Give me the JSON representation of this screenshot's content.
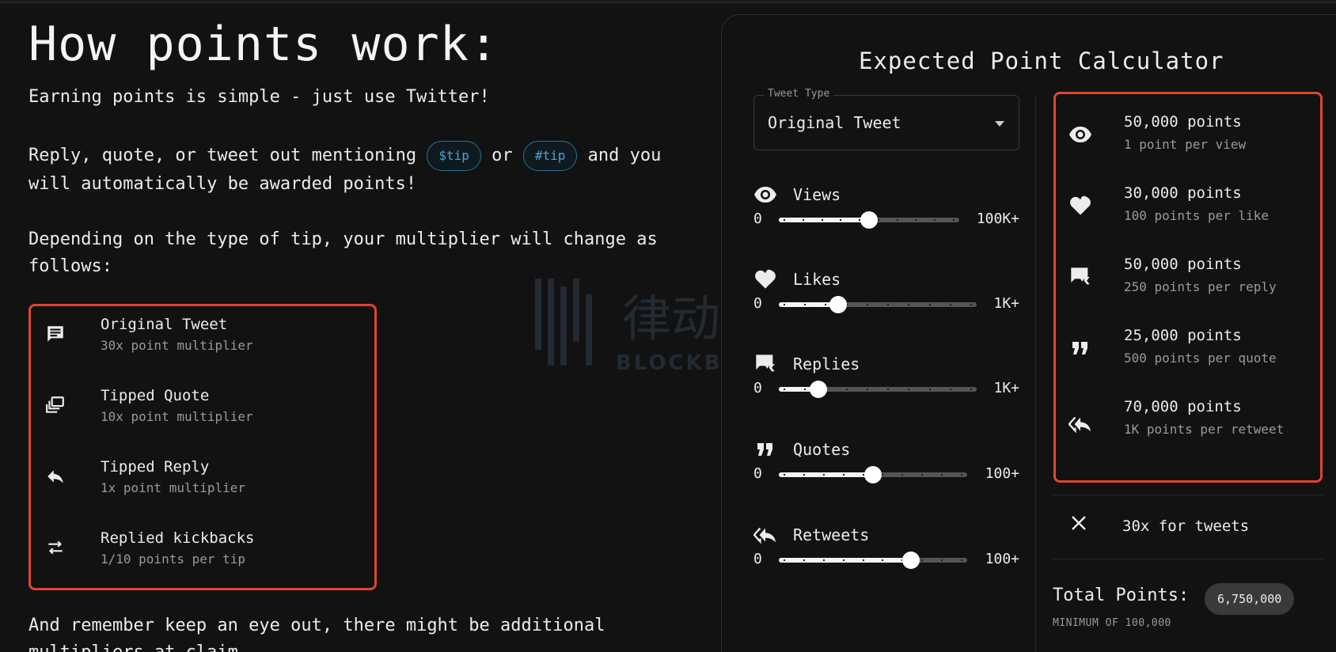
{
  "left": {
    "title": "How points work:",
    "intro": "Earning points is simple - just use Twitter!",
    "mention_pre": "Reply, quote, or tweet out mentioning",
    "tag1": "$tip",
    "mention_or": "or",
    "tag2": "#tip",
    "mention_post": "and you will automatically be awarded points!",
    "depending": "Depending on the type of tip, your multiplier will change as follows:",
    "multipliers": [
      {
        "icon": "comment-icon",
        "title": "Original Tweet",
        "desc": "30x point multiplier"
      },
      {
        "icon": "quote-stack-icon",
        "title": "Tipped Quote",
        "desc": "10x point multiplier"
      },
      {
        "icon": "reply-icon",
        "title": "Tipped Reply",
        "desc": "1x point multiplier"
      },
      {
        "icon": "swap-icon",
        "title": "Replied kickbacks",
        "desc": "1/10 points per tip"
      }
    ],
    "remember": "And remember keep an eye out, there might be additional multipliers at claim"
  },
  "calculator": {
    "title": "Expected Point Calculator",
    "tweet_type_label": "Tweet Type",
    "tweet_type_value": "Original Tweet",
    "sliders": [
      {
        "icon": "eye-icon",
        "label": "Views",
        "min": "0",
        "max": "100K+",
        "value_fraction": 0.5
      },
      {
        "icon": "heart-icon",
        "label": "Likes",
        "min": "0",
        "max": "1K+",
        "value_fraction": 0.3
      },
      {
        "icon": "reply-chat-icon",
        "label": "Replies",
        "min": "0",
        "max": "1K+",
        "value_fraction": 0.2
      },
      {
        "icon": "quote-icon",
        "label": "Quotes",
        "min": "0",
        "max": "100+",
        "value_fraction": 0.5
      },
      {
        "icon": "reply-all-icon",
        "label": "Retweets",
        "min": "0",
        "max": "100+",
        "value_fraction": 0.7
      }
    ],
    "results": [
      {
        "icon": "eye-icon",
        "points": "50,000 points",
        "rate": "1 point per view"
      },
      {
        "icon": "heart-icon",
        "points": "30,000 points",
        "rate": "100 points per like"
      },
      {
        "icon": "reply-chat-icon",
        "points": "50,000 points",
        "rate": "250 points per reply"
      },
      {
        "icon": "quote-icon",
        "points": "25,000 points",
        "rate": "500 points per quote"
      },
      {
        "icon": "reply-all-icon",
        "points": "70,000 points",
        "rate": "1K points per retweet"
      }
    ],
    "multiplier_text": "30x for tweets",
    "total_label": "Total Points:",
    "total_value": "6,750,000",
    "minimum": "MINIMUM OF 100,000"
  },
  "watermark": {
    "cn": "律动",
    "en": "BLOCKBEATS"
  },
  "colors": {
    "accent_border": "#e0452e",
    "tag_blue": "#4ba3d6",
    "background": "#121212"
  }
}
